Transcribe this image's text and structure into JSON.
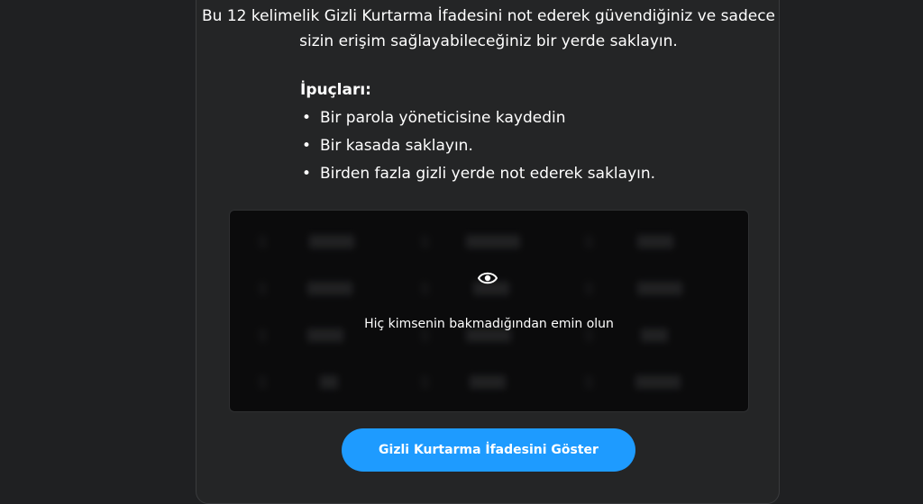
{
  "intro": {
    "text": "Bu 12 kelimelik Gizli Kurtarma İfadesini not ederek güvendiğiniz ve sadece sizin erişim sağlayabileceğiniz bir yerde saklayın."
  },
  "tips": {
    "title": "İpuçları:",
    "items": [
      "Bir parola yöneticisine kaydedin",
      "Bir kasada saklayın.",
      "Birden fazla gizli yerde not ederek saklayın."
    ]
  },
  "phrase_box": {
    "reveal_icon": "eye-icon",
    "message": "Hiç kimsenin bakmadığından emin olun"
  },
  "reveal_button": {
    "label": "Gizli Kurtarma İfadesini Göster"
  },
  "colors": {
    "accent": "#1e9bff",
    "background": "#1f2022",
    "panel": "#242526",
    "phrase_box": "#0b0b0c"
  }
}
